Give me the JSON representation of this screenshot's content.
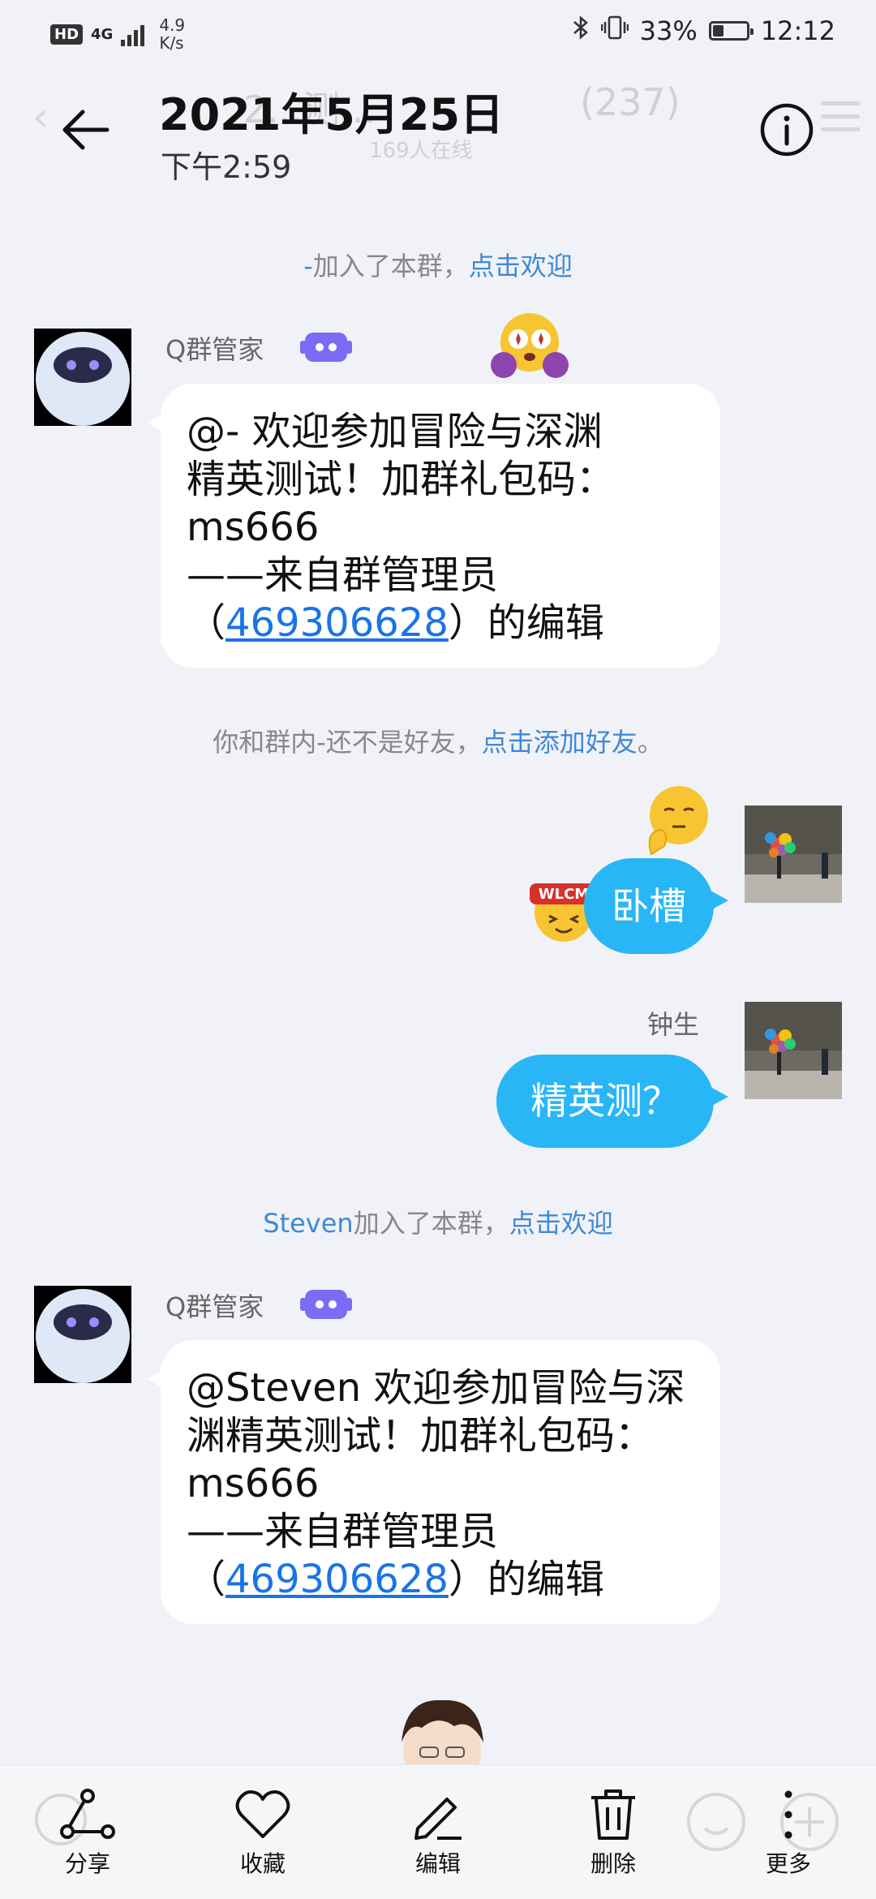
{
  "status_bar": {
    "hd": "HD",
    "network": "4G",
    "speed_value": "4.9",
    "speed_unit": "K/s",
    "battery": "33%",
    "battery_level": 0.33,
    "time": "12:12"
  },
  "header": {
    "title": "2021年5月25日",
    "subtitle": "下午2:59",
    "ghost_group_name": "2...测...",
    "ghost_member_count": "(237)",
    "ghost_online": "169人在线"
  },
  "messages": {
    "notice1": {
      "name": "-",
      "text": "加入了本群，",
      "action": "点击欢迎"
    },
    "bot1": {
      "sender": "Q群管家",
      "line1": "@- 欢迎参加冒险与深渊",
      "line2": "精英测试！加群礼包码：",
      "line3": "ms666",
      "line4": "——来自群管理员",
      "line5_open": "（",
      "line5_link": "469306628",
      "line5_close": "）的编辑"
    },
    "notice2": {
      "text": "你和群内-还不是好友，",
      "action": "点击添加好友",
      "tail": "。"
    },
    "self1": {
      "text": "卧槽"
    },
    "self2": {
      "sender": "钟生",
      "text": "精英测？"
    },
    "notice3": {
      "name": "Steven",
      "text": "加入了本群，",
      "action": "点击欢迎"
    },
    "bot2": {
      "sender": "Q群管家",
      "line1": "@Steven 欢迎参加冒险与深",
      "line2": "渊精英测试！加群礼包码：",
      "line3": "ms666",
      "line4": "——来自群管理员",
      "line5_open": "（",
      "line5_link": "469306628",
      "line5_close": "）的编辑"
    }
  },
  "emoji": {
    "wlcm_text": "WLCM"
  },
  "toolbar": {
    "share": "分享",
    "favorite": "收藏",
    "edit": "编辑",
    "delete": "删除",
    "more": "更多"
  },
  "colors": {
    "background": "#f1f2f7",
    "bubble_out": "#29b6f6",
    "link": "#1a73e8",
    "notice_action": "#3d8ad8"
  }
}
